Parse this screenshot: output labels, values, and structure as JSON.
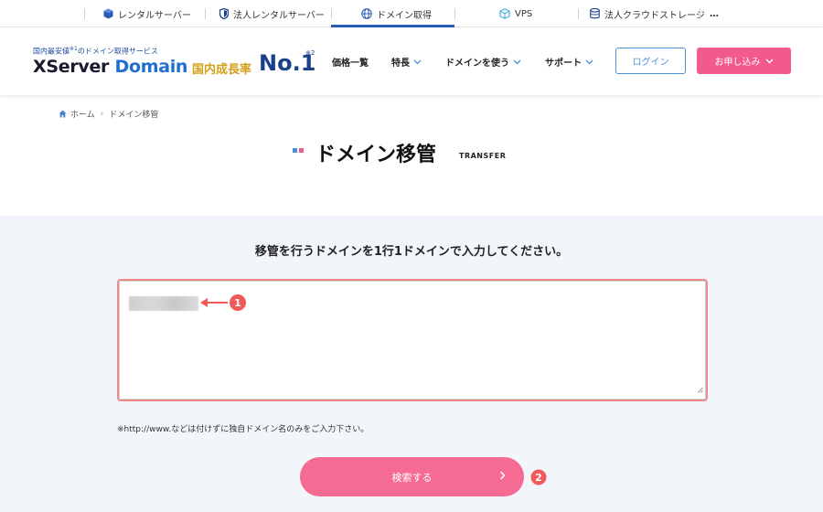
{
  "topbar": {
    "tabs": [
      {
        "label": "レンタルサーバー",
        "icon": "server-cube-icon"
      },
      {
        "label": "法人レンタルサーバー",
        "icon": "shield-icon"
      },
      {
        "label": "ドメイン取得",
        "icon": "globe-icon",
        "active": true
      },
      {
        "label": "VPS",
        "icon": "cube-icon"
      },
      {
        "label": "法人クラウドストレージ",
        "icon": "database-icon"
      }
    ],
    "more_label": "…"
  },
  "header": {
    "tagline": "国内最安値",
    "tagline_note": "※1",
    "tagline_rest": "のドメイン取得サービス",
    "logo_prefix": "XServer",
    "logo_domain": "Domain",
    "growth_label": "国内成長率",
    "growth_value": "No.1",
    "growth_note": "※2",
    "nav": [
      {
        "label": "価格一覧"
      },
      {
        "label": "特長"
      },
      {
        "label": "ドメインを使う"
      },
      {
        "label": "サポート"
      }
    ],
    "login_label": "ログイン",
    "apply_label": "お申し込み"
  },
  "breadcrumb": {
    "home": "ホーム",
    "separator": "›",
    "current": "ドメイン移管"
  },
  "page": {
    "title": "ドメイン移管",
    "subtitle": "TRANSFER"
  },
  "form": {
    "instruction": "移管を行うドメインを1行1ドメインで入力してください。",
    "note": "※http://www.などは付けずに独自ドメイン名のみをご入力下さい。",
    "search_label": "検索する",
    "markers": [
      "1",
      "2"
    ]
  },
  "colors": {
    "accent_blue": "#2a5bb5",
    "pink": "#f25a8b",
    "highlight_red": "#f08a8a",
    "section_bg": "#f2f6fb"
  }
}
